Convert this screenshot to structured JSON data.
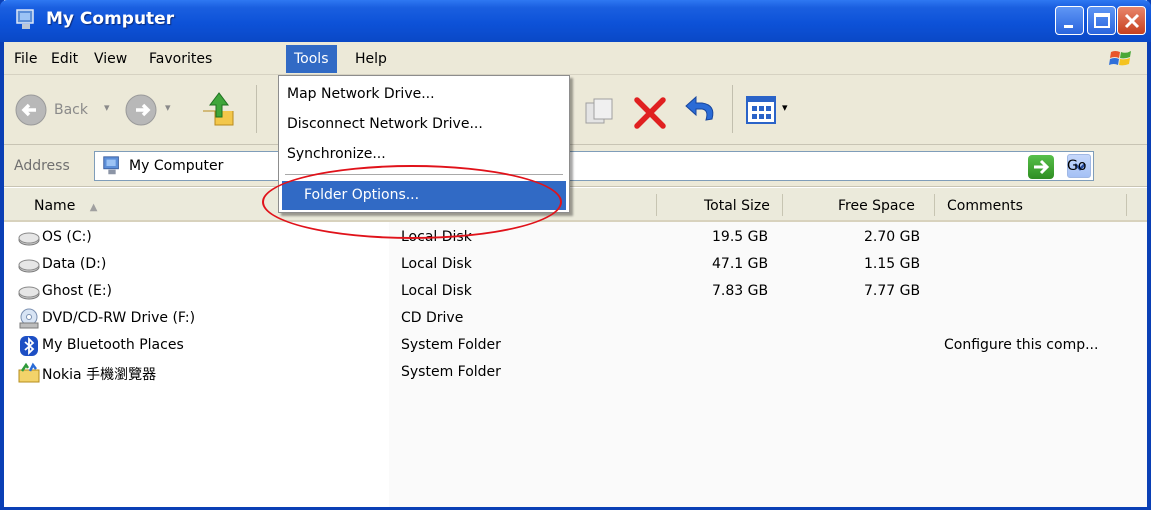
{
  "window": {
    "title": "My Computer"
  },
  "menu": {
    "items": [
      "File",
      "Edit",
      "View",
      "Favorites",
      "Tools",
      "Help"
    ],
    "active": "Tools"
  },
  "toolbar": {
    "back_label": "Back"
  },
  "address": {
    "label": "Address",
    "value": "My Computer",
    "go_label": "Go"
  },
  "columns": {
    "name": "Name",
    "total_size": "Total Size",
    "free_space": "Free Space",
    "comments": "Comments"
  },
  "rows": [
    {
      "name": "OS (C:)",
      "type": "Local Disk",
      "total": "19.5 GB",
      "free": "2.70 GB",
      "comments": "",
      "icon": "hard-drive-icon"
    },
    {
      "name": "Data (D:)",
      "type": "Local Disk",
      "total": "47.1 GB",
      "free": "1.15 GB",
      "comments": "",
      "icon": "hard-drive-icon"
    },
    {
      "name": "Ghost (E:)",
      "type": "Local Disk",
      "total": "7.83 GB",
      "free": "7.77 GB",
      "comments": "",
      "icon": "hard-drive-icon"
    },
    {
      "name": "DVD/CD-RW Drive (F:)",
      "type": "CD Drive",
      "total": "",
      "free": "",
      "comments": "",
      "icon": "cd-drive-icon"
    },
    {
      "name": "My Bluetooth Places",
      "type": "System Folder",
      "total": "",
      "free": "",
      "comments": "Configure this comp...",
      "icon": "bluetooth-icon"
    },
    {
      "name": "Nokia 手機瀏覽器",
      "type": "System Folder",
      "total": "",
      "free": "",
      "comments": "",
      "icon": "nokia-folder-icon"
    }
  ],
  "tools_menu": {
    "items": [
      "Map Network Drive...",
      "Disconnect Network Drive...",
      "Synchronize...",
      "Folder Options..."
    ],
    "highlighted": "Folder Options..."
  },
  "colors": {
    "title_blue": "#0d52d8",
    "highlight": "#316ac5",
    "annotation_red": "#e0121a"
  }
}
